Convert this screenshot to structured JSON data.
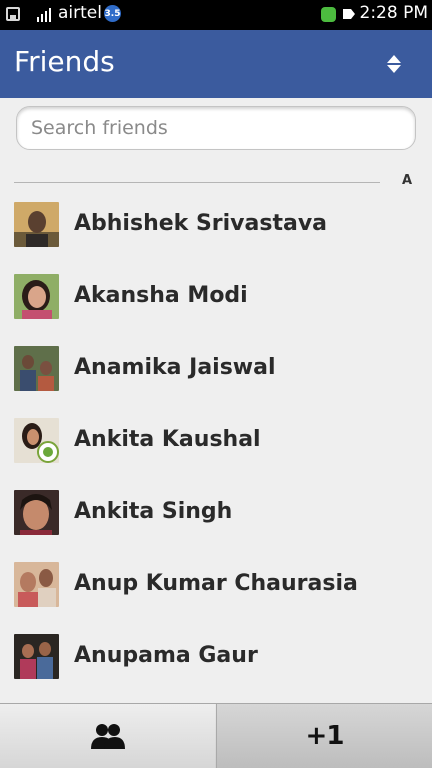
{
  "status_bar": {
    "carrier": "airtel",
    "network_badge": "3.5",
    "time": "2:28 PM",
    "icons": [
      "battery-icon",
      "signal-icon",
      "online-status-icon",
      "notification-icon"
    ]
  },
  "header": {
    "title": "Friends",
    "color": "#3b5b9e",
    "sort_icon": "sort-icon"
  },
  "search": {
    "placeholder": "Search friends",
    "value": ""
  },
  "section": {
    "letter": "A"
  },
  "friends": [
    {
      "name": "Abhishek Srivastava"
    },
    {
      "name": "Akansha Modi"
    },
    {
      "name": "Anamika Jaiswal"
    },
    {
      "name": "Ankita Kaushal"
    },
    {
      "name": "Ankita Singh"
    },
    {
      "name": "Anup Kumar Chaurasia"
    },
    {
      "name": "Anupama Gaur"
    }
  ],
  "toolbar": {
    "friends_tab_icon": "friends-icon",
    "plus_one_label": "+1"
  }
}
